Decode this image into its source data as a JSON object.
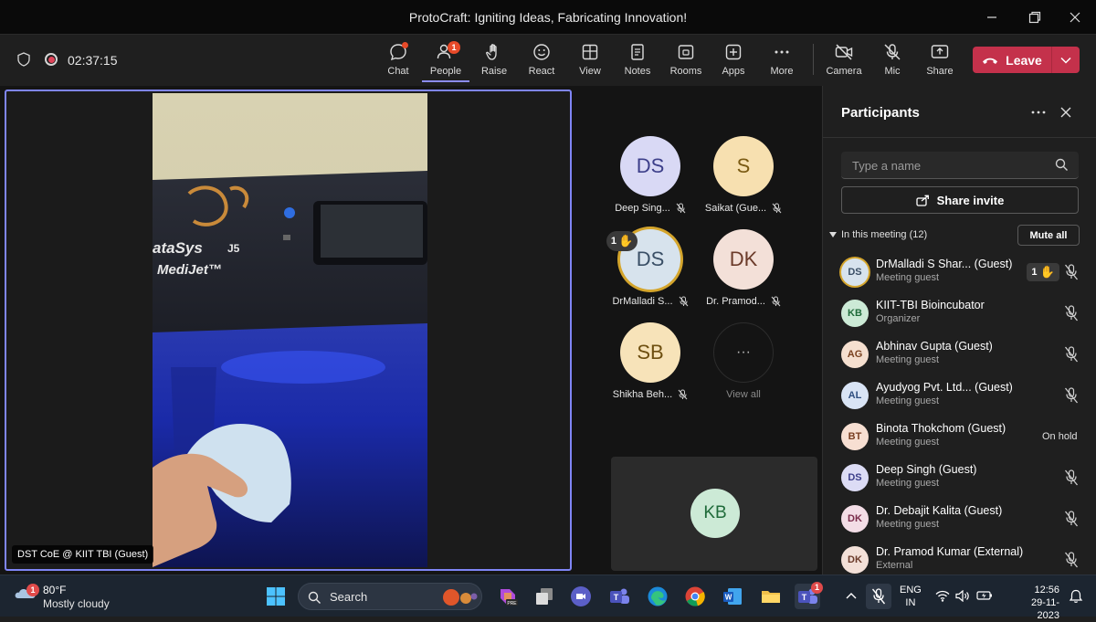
{
  "window": {
    "title": "ProtoCraft: Igniting Ideas, Fabricating Innovation!"
  },
  "toolbar": {
    "timer": "02:37:15",
    "buttons": [
      {
        "label": "Chat"
      },
      {
        "label": "People",
        "badge": "1"
      },
      {
        "label": "Raise"
      },
      {
        "label": "React"
      },
      {
        "label": "View"
      },
      {
        "label": "Notes"
      },
      {
        "label": "Rooms"
      },
      {
        "label": "Apps"
      },
      {
        "label": "More"
      }
    ],
    "device_buttons": [
      {
        "label": "Camera"
      },
      {
        "label": "Mic"
      },
      {
        "label": "Share"
      }
    ],
    "leave_label": "Leave"
  },
  "stage": {
    "main_video_label": "DST CoE @ KIIT TBI (Guest)",
    "video_text": {
      "logo": "ataSys",
      "model": "J5",
      "brand": "MediJet™"
    },
    "tiles": [
      {
        "initials": "DS",
        "name": "Deep Sing...",
        "color": "#d9d9f5",
        "text": "#3d3f8a"
      },
      {
        "initials": "S",
        "name": "Saikat (Gue...",
        "color": "#f7e0b0",
        "text": "#7a5a12"
      },
      {
        "initials": "DS",
        "name": "DrMalladi S...",
        "color": "#d7e3ed",
        "text": "#3a4f66",
        "hand": "1"
      },
      {
        "initials": "DK",
        "name": "Dr. Pramod...",
        "color": "#f3e0d8",
        "text": "#6b3b2a"
      },
      {
        "initials": "SB",
        "name": "Shikha Beh...",
        "color": "#f7e3b9",
        "text": "#6e4f10"
      },
      {
        "initials": "···",
        "name": "View all"
      }
    ],
    "featured_tile": {
      "initials": "KB"
    }
  },
  "participants": {
    "title": "Participants",
    "search_placeholder": "Type a name",
    "share_invite": "Share invite",
    "section_label": "In this meeting (12)",
    "mute_all": "Mute all",
    "list": [
      {
        "initials": "DS",
        "name": "DrMalladi S Shar... (Guest)",
        "role": "Meeting guest",
        "color": "#d7e3ed",
        "text": "#3a4f66",
        "hand": "1"
      },
      {
        "initials": "KB",
        "name": "KIIT-TBI Bioincubator",
        "role": "Organizer",
        "color": "#ccead6",
        "text": "#1f6b3a"
      },
      {
        "initials": "AG",
        "name": "Abhinav Gupta (Guest)",
        "role": "Meeting guest",
        "color": "#f5dfcf",
        "text": "#7a4220"
      },
      {
        "initials": "AL",
        "name": "Ayudyog Pvt. Ltd... (Guest)",
        "role": "Meeting guest",
        "color": "#d9e4f5",
        "text": "#2f4f80"
      },
      {
        "initials": "BT",
        "name": "Binota Thokchom (Guest)",
        "role": "Meeting guest",
        "color": "#f7dfd2",
        "text": "#7a3f22",
        "status": "On hold"
      },
      {
        "initials": "DS",
        "name": "Deep Singh (Guest)",
        "role": "Meeting guest",
        "color": "#dcdcf5",
        "text": "#3d3f8a"
      },
      {
        "initials": "DK",
        "name": "Dr. Debajit Kalita (Guest)",
        "role": "Meeting guest",
        "color": "#f3dde6",
        "text": "#7a2c4b"
      },
      {
        "initials": "DK",
        "name": "Dr. Pramod Kumar (External)",
        "role": "External",
        "color": "#f3e0d8",
        "text": "#6b3b2a"
      }
    ]
  },
  "taskbar": {
    "weather_temp": "80°F",
    "weather_desc": "Mostly cloudy",
    "weather_badge": "1",
    "search_label": "Search",
    "teams_badge": "1",
    "lang": "ENG",
    "region": "IN",
    "time": "12:56",
    "date": "29-11-2023"
  }
}
